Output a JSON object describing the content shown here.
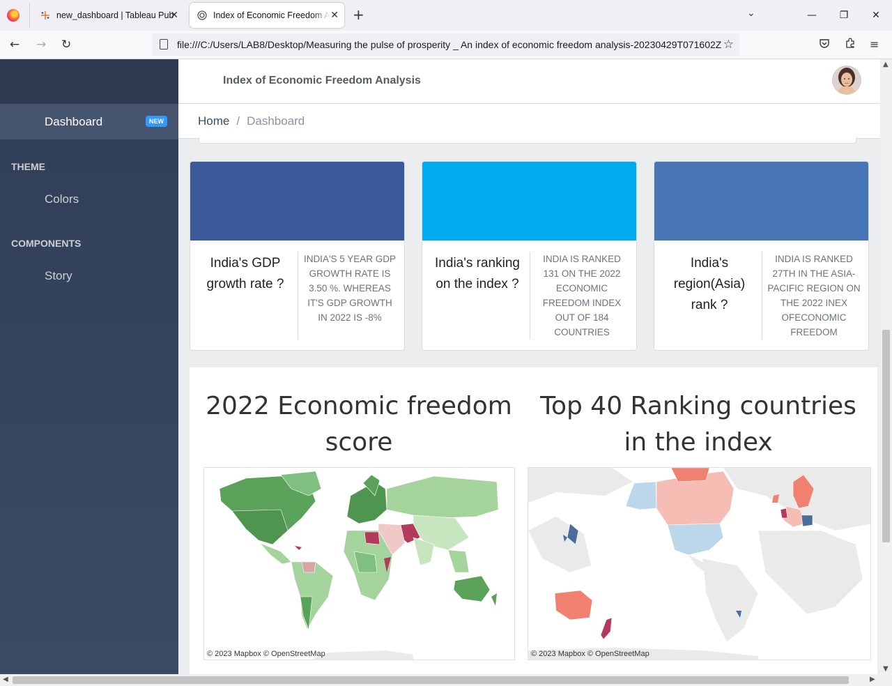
{
  "browser": {
    "tabs": [
      {
        "title": "new_dashboard | Tableau Public",
        "active": false
      },
      {
        "title": "Index of Economic Freedom Analysis",
        "active": true
      }
    ],
    "url": "file:///C:/Users/LAB8/Desktop/Measuring the pulse of prosperity _ An index of economic freedom analysis-20230429T071602Z"
  },
  "sidebar": {
    "dashboard_label": "Dashboard",
    "dashboard_badge": "NEW",
    "sections": [
      {
        "title": "THEME",
        "items": [
          "Colors"
        ]
      },
      {
        "title": "COMPONENTS",
        "items": [
          "Story"
        ]
      }
    ]
  },
  "header": {
    "title": "Index of Economic Freedom Analysis"
  },
  "breadcrumb": {
    "home": "Home",
    "separator": "/",
    "current": "Dashboard"
  },
  "cards": [
    {
      "color": "#3b5998",
      "question": "India's GDP growth rate ?",
      "answer": "INDIA'S 5 YEAR GDP GROWTH RATE IS 3.50 %. WHEREAS IT'S GDP GROWTH IN 2022 IS -8%"
    },
    {
      "color": "#00aced",
      "question": "India's ranking on the index ?",
      "answer": "INDIA IS RANKED 131 ON THE 2022 ECONOMIC FREEDOM INDEX OUT OF 184 COUNTRIES"
    },
    {
      "color": "#4875b4",
      "question": "India's region(Asia) rank ?",
      "answer": "INDIA IS RANKED 27TH IN THE ASIA-PACIFIC REGION ON THE 2022 INEX OFECONOMIC FREEDOM"
    }
  ],
  "viz": {
    "left": {
      "title": "2022 Economic freedom score",
      "credit": "© 2023 Mapbox  © OpenStreetMap"
    },
    "right": {
      "title": "Top 40 Ranking countries in the index",
      "credit": "© 2023 Mapbox  © OpenStreetMap"
    }
  }
}
